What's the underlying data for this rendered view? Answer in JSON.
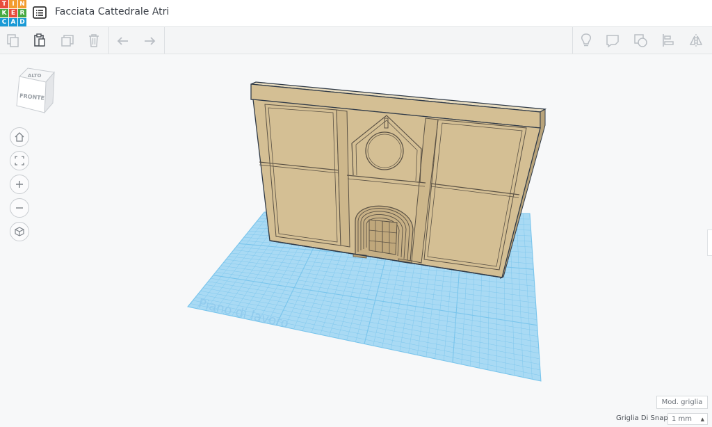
{
  "app": {
    "logo_letters": [
      "T",
      "I",
      "N",
      "K",
      "E",
      "R",
      "C",
      "A",
      "D"
    ],
    "logo_colors": [
      "#e84d3d",
      "#f39c2f",
      "#f39c2f",
      "#48a942",
      "#e84d3d",
      "#48a942",
      "#1a9ad6",
      "#1a9ad6",
      "#1a9ad6"
    ],
    "design_title": "Facciata Cattedrale Atri"
  },
  "toolbar": {
    "left_tools": [
      "copy-icon",
      "paste-icon",
      "duplicate-icon",
      "trash-icon",
      "undo-icon",
      "redo-icon"
    ],
    "right_tools": [
      "light-bulb-icon",
      "note-icon",
      "group-shape-icon",
      "align-icon",
      "mirror-icon"
    ]
  },
  "viewcube": {
    "top_label": "ALTO",
    "front_label": "FRONTE"
  },
  "navigation": [
    "home-view-icon",
    "fit-view-icon",
    "zoom-in-icon",
    "zoom-out-icon",
    "orthographic-icon"
  ],
  "workplane": {
    "label": "Piano di lavoro",
    "color": "#a9daf4",
    "line_color": "#7ac5ec"
  },
  "model": {
    "color": "#d4bf94",
    "outline": "#2f3a48"
  },
  "footer": {
    "edit_grid_label": "Mod. griglia",
    "snap_label": "Griglia Di Snap",
    "snap_value": "1 mm"
  }
}
